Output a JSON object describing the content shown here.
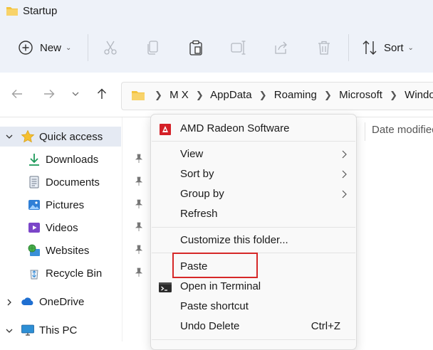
{
  "window": {
    "title": "Startup"
  },
  "toolbar": {
    "new_label": "New",
    "sort_label": "Sort"
  },
  "address": {
    "crumbs": [
      "M X",
      "AppData",
      "Roaming",
      "Microsoft",
      "Windows"
    ]
  },
  "nav": {
    "quick_access": "Quick access",
    "items": [
      "Downloads",
      "Documents",
      "Pictures",
      "Videos",
      "Websites",
      "Recycle Bin"
    ],
    "onedrive": "OneDrive",
    "this_pc": "This PC"
  },
  "content": {
    "column_header": "Date modified"
  },
  "context_menu": {
    "header": "AMD Radeon Software",
    "view": "View",
    "sort_by": "Sort by",
    "group_by": "Group by",
    "refresh": "Refresh",
    "customize": "Customize this folder...",
    "paste": "Paste",
    "open_terminal": "Open in Terminal",
    "paste_shortcut": "Paste shortcut",
    "undo_delete": "Undo Delete",
    "undo_delete_shortcut": "Ctrl+Z"
  },
  "colors": {
    "folder": "#f3c33e",
    "accent": "#0067c0",
    "highlight_border": "#d62828",
    "amd_red": "#d42027"
  }
}
